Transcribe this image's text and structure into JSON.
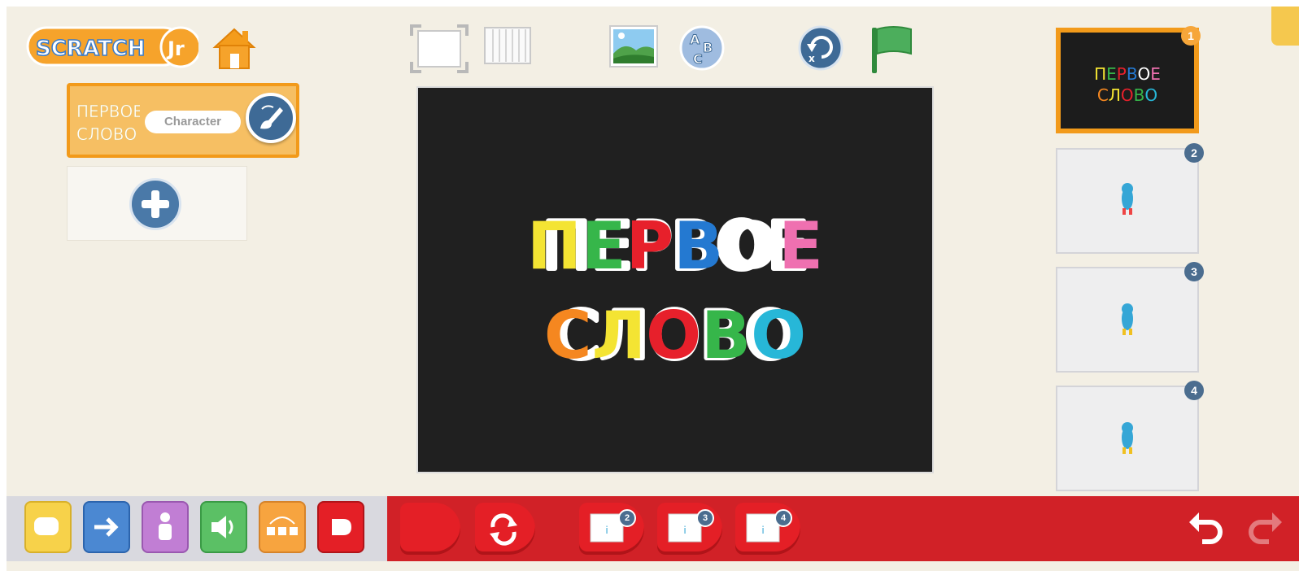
{
  "app": {
    "logo_text": "ScratchJr",
    "logo_suffix": "Jr"
  },
  "toolbar": {
    "home_icon": "home-icon",
    "fullscreen_icon": "fullscreen-icon",
    "grid_icon": "grid-icon",
    "background_icon": "landscape-icon",
    "text_icon": "abc-icon",
    "reset_icon": "reset-characters-icon",
    "green_flag_icon": "green-flag-icon"
  },
  "sprites": [
    {
      "thumb_line1": "ПЕРВОЕ",
      "thumb_line2": "СЛОВО",
      "name": "Character",
      "paint_icon": "paintbrush-icon"
    }
  ],
  "add_sprite_icon": "plus-icon",
  "stage": {
    "line1": "ПЕРВОЕ",
    "line2": "СЛОВО"
  },
  "pages": [
    {
      "number": "1",
      "selected": true,
      "title_line1": "ПЕРВОЕ",
      "title_line2": "СЛОВО"
    },
    {
      "number": "2",
      "selected": false
    },
    {
      "number": "3",
      "selected": false
    },
    {
      "number": "4",
      "selected": false
    }
  ],
  "categories": [
    {
      "name": "triggering",
      "color": "#f7d24a"
    },
    {
      "name": "motion",
      "color": "#4b88d2"
    },
    {
      "name": "looks",
      "color": "#c17ed4"
    },
    {
      "name": "sound",
      "color": "#5bc065"
    },
    {
      "name": "control",
      "color": "#f7a43f"
    },
    {
      "name": "end",
      "color": "#e41f26"
    }
  ],
  "blocks": [
    {
      "name": "end-block"
    },
    {
      "name": "repeat-forever-block"
    },
    {
      "name": "go-to-page",
      "page": "2"
    },
    {
      "name": "go-to-page",
      "page": "3"
    },
    {
      "name": "go-to-page",
      "page": "4"
    }
  ],
  "colors": {
    "orange": "#f29a1a",
    "stage_bg": "#202020",
    "palette_red": "#d12127",
    "badge_blue": "#4b6d8f"
  }
}
